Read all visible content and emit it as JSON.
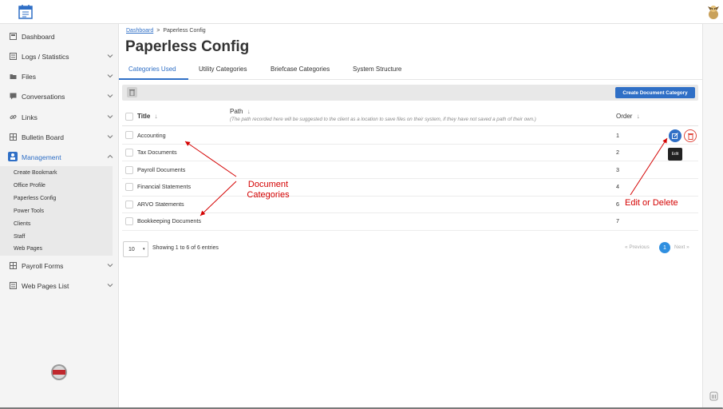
{
  "colors": {
    "accent": "#2f6fc6",
    "annotation": "#d40000",
    "danger": "#e04a3f"
  },
  "sidebar": {
    "items": [
      {
        "label": "Dashboard",
        "icon": "dashboard-icon"
      },
      {
        "label": "Logs / Statistics",
        "icon": "logs-icon"
      },
      {
        "label": "Files",
        "icon": "folder-icon"
      },
      {
        "label": "Conversations",
        "icon": "chat-icon"
      },
      {
        "label": "Links",
        "icon": "link-icon"
      },
      {
        "label": "Bulletin Board",
        "icon": "board-icon"
      },
      {
        "label": "Management",
        "icon": "management-icon"
      },
      {
        "label": "Payroll Forms",
        "icon": "table-icon"
      },
      {
        "label": "Web Pages List",
        "icon": "list-icon"
      }
    ],
    "management_subitems": [
      "Create Bookmark",
      "Office Profile",
      "Paperless Config",
      "Power Tools",
      "Clients",
      "Staff",
      "Web Pages"
    ]
  },
  "breadcrumb": {
    "root": "Dashboard",
    "separator": ">",
    "current": "Paperless Config"
  },
  "page_title": "Paperless Config",
  "tabs": [
    "Categories Used",
    "Utility Categories",
    "Briefcase Categories",
    "System Structure"
  ],
  "toolbar": {
    "create_label": "Create Document Category"
  },
  "table": {
    "headers": {
      "title": "Title",
      "path": "Path",
      "order": "Order",
      "sort_icon": "↓"
    },
    "path_note": "(The path recorded here will be suggested to the client as a location to save files on their system, if they have not saved a path of their own.)",
    "rows": [
      {
        "title": "Accounting",
        "order": "1"
      },
      {
        "title": "Tax Documents",
        "order": "2"
      },
      {
        "title": "Payroll Documents",
        "order": "3"
      },
      {
        "title": "Financial Statements",
        "order": "4"
      },
      {
        "title": "ARVO Statements",
        "order": "6"
      },
      {
        "title": "Bookkeeping Documents",
        "order": "7"
      }
    ],
    "edit_tooltip": "Edit"
  },
  "footer": {
    "page_length": "10",
    "showing": "Showing 1 to 6 of 6 entries",
    "previous": "« Previous",
    "current_page": "1",
    "next": "Next »"
  },
  "annotations": {
    "document_categories_line1": "Document",
    "document_categories_line2": "Categories",
    "edit_or_delete": "Edit or Delete"
  }
}
